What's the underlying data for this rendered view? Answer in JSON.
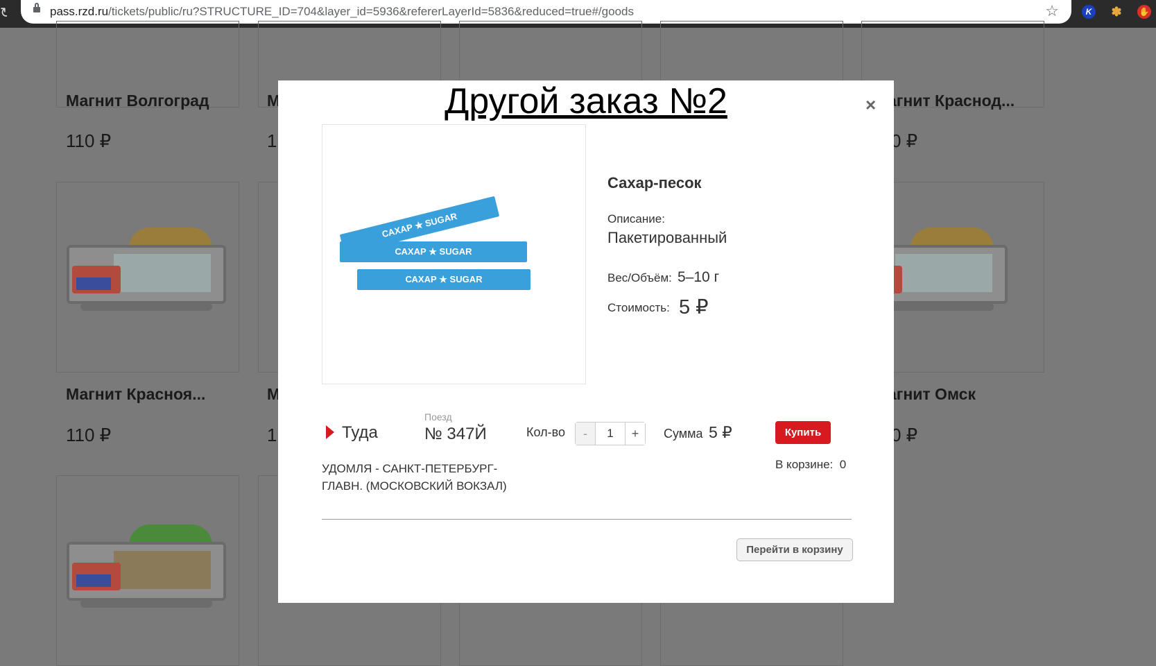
{
  "browser": {
    "url_host": "pass.rzd.ru",
    "url_rest": "/tickets/public/ru?STRUCTURE_ID=704&layer_id=5936&refererLayerId=5836&reduced=true#/goods",
    "star_icon": "star-icon",
    "extensions": [
      "kaspersky-icon",
      "paw-icon",
      "adblock-icon"
    ]
  },
  "background_cards": [
    {
      "title": "Магнит Волгоград",
      "price": "110 ₽"
    },
    {
      "title": "М",
      "price": "1"
    },
    {
      "title": "агнит Краснод...",
      "price": "0 ₽"
    },
    {
      "title": "Магнит Красноя...",
      "price": "110 ₽"
    },
    {
      "title": "М",
      "price": "1"
    },
    {
      "title": "агнит Омск",
      "price": "0 ₽"
    }
  ],
  "modal": {
    "heading": "Другой заказ №2",
    "close": "×",
    "product_name": "Сахар-песок",
    "description_label": "Описание:",
    "description": "Пакетированный",
    "weight_label": "Вес/Объём:",
    "weight": "5–10 г",
    "cost_label": "Стоимость:",
    "cost": "5 ₽",
    "sugar_stick_text": "САХАР ★ SUGAR",
    "direction": "Туда",
    "train_label": "Поезд",
    "train_number": "№ 347Й",
    "qty_label": "Кол-во",
    "qty_minus": "-",
    "qty_value": "1",
    "qty_plus": "+",
    "sum_label": "Сумма",
    "sum_value": "5 ₽",
    "buy_label": "Купить",
    "route": "УДОМЛЯ - САНКТ-ПЕТЕРБУРГ-ГЛАВН. (МОСКОВСКИЙ ВОКЗАЛ)",
    "in_cart_label": "В корзине:",
    "in_cart_value": "0",
    "go_to_cart": "Перейти в корзину"
  },
  "colors": {
    "accent_red": "#d71920",
    "overlay": "#7a7a7a",
    "sugar_blue": "#3aa0dc"
  }
}
